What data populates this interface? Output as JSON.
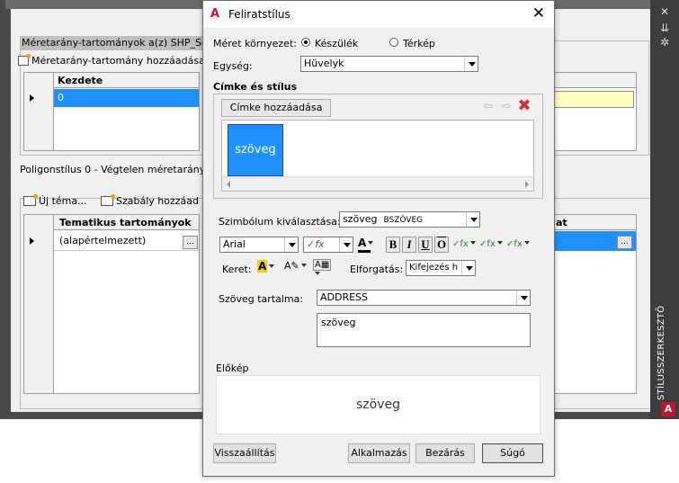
{
  "background": {
    "scale_ranges_title": "Méretarány-tartományok a(z) SHP_Sc",
    "add_scale_range": "Méretarány-tartomány hozzáadása",
    "grid1_header": "Kezdete",
    "grid1_value": "0",
    "polygon_title": "Poligonstílus 0 - Végtelen méretarány",
    "new_theme": "Új téma...",
    "add_rule": "Szabály hozzáad",
    "grid2_header": "Tematikus tartományok",
    "grid2_row": "(alapértelmezett)",
    "grid2_right_header": "at",
    "ellipsis": "...",
    "side_panel_label": "STÍLUSSZERKESZTŐ",
    "app_logo": "A"
  },
  "dialog": {
    "title": "Feliratstílus",
    "app_logo": "A",
    "close": "✕",
    "size_context_label": "Méret környezet:",
    "device_option": "Készülék",
    "map_option": "Térkép",
    "selected_context": "Készülék",
    "unit_label": "Egység:",
    "unit_value": "Hüvelyk",
    "labels_group_title": "Címke és stílus",
    "add_label_button": "Címke hozzáadása",
    "sample_label": "szöveg",
    "symbol_label": "Szimbólum kiválasztása:",
    "symbol_value_text": "szöveg",
    "symbol_value_caps": "BSZÖVEG",
    "font_value": "Arial",
    "bold": "B",
    "italic": "I",
    "underline": "U",
    "overline": "O",
    "border_label": "Keret:",
    "rotation_label": "Elforgatás:",
    "rotation_value": "Kifejezés h",
    "content_label": "Szöveg tartalma:",
    "content_value": "ADDRESS",
    "text_value": "szöveg",
    "preview_label": "Előkép",
    "preview_text": "szöveg",
    "reset_button": "Visszaállítás",
    "apply_button": "Alkalmazás",
    "close_button": "Bezárás",
    "help_button": "Súgó"
  },
  "colors": {
    "accent_blue": "#1e90ff",
    "brand_red": "#c8102e",
    "highlight_yellow": "#ffffc0"
  }
}
